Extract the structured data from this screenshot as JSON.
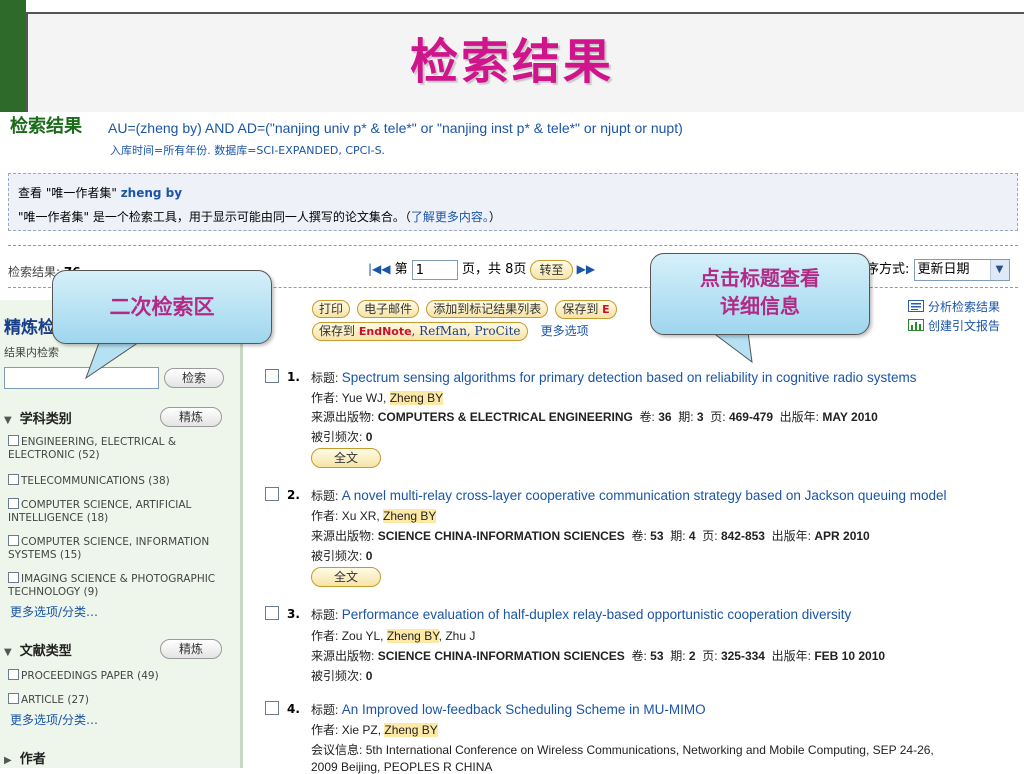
{
  "slide": {
    "title": "检索结果"
  },
  "query": {
    "heading": "检索结果",
    "expression": "AU=(zheng by) AND AD=(\"nanjing univ p* & tele*\" or \"nanjing inst p* & tele*\" or njupt or nupt)",
    "meta": "入库时间=所有年份. 数据库=SCI-EXPANDED, CPCI-S."
  },
  "info_box": {
    "line1_prefix": "查看 \"唯一作者集\"",
    "line1_author": "zheng by",
    "line2_text": "\"唯一作者集\" 是一个检索工具，用于显示可能由同一人撰写的论文集合。（",
    "line2_link": "了解更多内容。",
    "line2_suffix": "）"
  },
  "pager": {
    "count_label": "检索结果:",
    "count_value": "76",
    "first_icon": "|◀◀",
    "page_prefix": "第",
    "page_value": "1",
    "page_suffix": "页，共 8页",
    "go_label": "转至",
    "next_icon": "▶▶"
  },
  "sort": {
    "label": "序方式:",
    "value": "更新日期"
  },
  "sidebar": {
    "title": "精炼检",
    "within_label": "结果内检索",
    "search_button": "检索",
    "subject": {
      "heading": "学科类别",
      "refine_button": "精炼",
      "items": [
        "ENGINEERING, ELECTRICAL & ELECTRONIC (52)",
        "TELECOMMUNICATIONS (38)",
        "COMPUTER SCIENCE, ARTIFICIAL INTELLIGENCE (18)",
        "COMPUTER SCIENCE, INFORMATION SYSTEMS (15)",
        "IMAGING SCIENCE & PHOTOGRAPHIC TECHNOLOGY (9)"
      ],
      "more": "更多选项/分类…"
    },
    "doctype": {
      "heading": "文献类型",
      "refine_button": "精炼",
      "items": [
        "PROCEEDINGS PAPER (49)",
        "ARTICLE (27)"
      ],
      "more": "更多选项/分类…"
    },
    "author": {
      "heading": "作者"
    }
  },
  "toolbar": {
    "print": "打印",
    "email": "电子邮件",
    "add_to_list": "添加到标记结果列表",
    "save_to": "保存到",
    "save_to_e": "E",
    "save_to2": "保存到",
    "endnote": "EndNote",
    "refman": ", RefMan, ProCite",
    "more_options": "更多选项",
    "analyze": "分析检索结果",
    "citation_report": "创建引文报告"
  },
  "results": [
    {
      "num": "1.",
      "title_label": "标题:",
      "title": "Spectrum sensing algorithms for primary detection based on reliability in cognitive radio systems",
      "author_label": "作者:",
      "authors_pre": "Yue WJ, ",
      "author_hl": "Zheng BY",
      "authors_post": "",
      "source_label": "来源出版物:",
      "source": "COMPUTERS & ELECTRICAL ENGINEERING",
      "vol_label": "卷:",
      "vol": "36",
      "issue_label": "期:",
      "issue": "3",
      "pages_label": "页:",
      "pages": "469-479",
      "year_label": "出版年:",
      "year": "MAY 2010",
      "cited_label": "被引频次:",
      "cited": "0",
      "fulltext": "全文"
    },
    {
      "num": "2.",
      "title_label": "标题:",
      "title": "A novel multi-relay cross-layer cooperative communication strategy based on Jackson queuing model",
      "author_label": "作者:",
      "authors_pre": "Xu XR, ",
      "author_hl": "Zheng BY",
      "authors_post": "",
      "source_label": "来源出版物:",
      "source": "SCIENCE CHINA-INFORMATION SCIENCES",
      "vol_label": "卷:",
      "vol": "53",
      "issue_label": "期:",
      "issue": "4",
      "pages_label": "页:",
      "pages": "842-853",
      "year_label": "出版年:",
      "year": "APR 2010",
      "cited_label": "被引频次:",
      "cited": "0",
      "fulltext": "全文"
    },
    {
      "num": "3.",
      "title_label": "标题:",
      "title": "Performance evaluation of half-duplex relay-based opportunistic cooperation diversity",
      "author_label": "作者:",
      "authors_pre": "Zou YL, ",
      "author_hl": "Zheng BY",
      "authors_post": ", Zhu J",
      "source_label": "来源出版物:",
      "source": "SCIENCE CHINA-INFORMATION SCIENCES",
      "vol_label": "卷:",
      "vol": "53",
      "issue_label": "期:",
      "issue": "2",
      "pages_label": "页:",
      "pages": "325-334",
      "year_label": "出版年:",
      "year": "FEB 10 2010",
      "cited_label": "被引频次:",
      "cited": "0"
    },
    {
      "num": "4.",
      "title_label": "标题:",
      "title": "An Improved low-feedback Scheduling Scheme in MU-MIMO",
      "author_label": "作者:",
      "authors_pre": "Xie PZ, ",
      "author_hl": "Zheng BY",
      "conf_label": "会议信息:",
      "conf": "5th International Conference on Wireless Communications, Networking and Mobile Computing, SEP 24-26,",
      "conf2": "2009 Beijing, PEOPLES R CHINA"
    }
  ],
  "callouts": {
    "refine_area": "二次检索区",
    "click_title_1": "点击标题查看",
    "click_title_2": "详细信息"
  }
}
